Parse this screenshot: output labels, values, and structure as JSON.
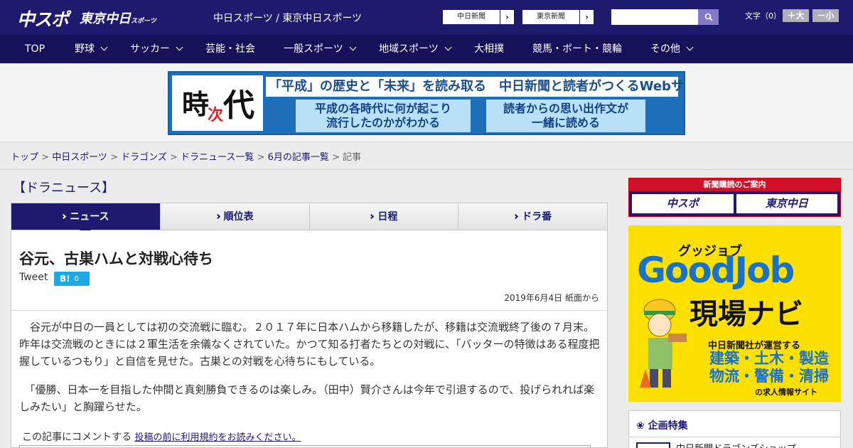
{
  "header": {
    "logo_main": "中スポ",
    "logo_sub": "東京中日",
    "logo_sub_small": "スポーツ",
    "title": "中日スポーツ / 東京中日スポーツ",
    "paper_links": [
      "中日新聞",
      "東京新聞"
    ],
    "fontsize_label": "文字（0）",
    "font_bigger": "＋大",
    "font_smaller": "－小"
  },
  "nav": {
    "items": [
      {
        "label": "TOP",
        "dropdown": false
      },
      {
        "label": "野球",
        "dropdown": true
      },
      {
        "label": "サッカー",
        "dropdown": true
      },
      {
        "label": "芸能・社会",
        "dropdown": false
      },
      {
        "label": "一般スポーツ",
        "dropdown": true
      },
      {
        "label": "地域スポーツ",
        "dropdown": true
      },
      {
        "label": "大相撲",
        "dropdown": false
      },
      {
        "label": "競馬・ボート・競輪",
        "dropdown": false
      },
      {
        "label": "その他",
        "dropdown": true
      }
    ]
  },
  "banner": {
    "kanji1": "時",
    "kanji2": "次",
    "kanji3": "代",
    "headline": "「平成」の歴史と「未来」を読み取る　中日新聞と読者がつくるWebサイト",
    "box1_line1": "平成の各時代に何が起こり",
    "box1_line2": "流行したのかがわかる",
    "box2_line1": "読者からの思い出作文が",
    "box2_line2": "一緒に読める"
  },
  "breadcrumb": {
    "items": [
      "トップ",
      "中日スポーツ",
      "ドラゴンズ",
      "ドラニュース一覧",
      "6月の記事一覧"
    ],
    "current": "記事",
    "sep": " > "
  },
  "section": {
    "title": "【ドラニュース】",
    "tabs": [
      "ニュース",
      "順位表",
      "日程",
      "ドラ番"
    ]
  },
  "article": {
    "title": "谷元、古巣ハムと対戦心待ち",
    "tweet": "Tweet",
    "hatena_b": "B!",
    "hatena_count": "0",
    "date": "2019年6月4日 紙面から",
    "para1": "　谷元が中日の一員としては初の交流戦に臨む。２０１７年に日本ハムから移籍したが、移籍は交流戦終了後の７月末。昨年は交流戦のときには２軍生活を余儀なくされていた。かつて知る打者たちとの対戦に、「バッターの特徴はある程度把握しているつもり」と自信を見せた。古巣との対戦を心待ちにもしている。",
    "para2": "　「優勝、日本一を目指した仲間と真剣勝負できるのは楽しみ。（田中）賢介さんは今年で引退するので、投げられれば楽しみたい」と胸躍らせた。",
    "comment_prompt": "この記事にコメントする",
    "comment_link": "投稿の前に利用規約をお読みください。"
  },
  "sidebar": {
    "sub_head": "新聞購読のご案内",
    "sub_logo1": "中スポ",
    "sub_logo2": "東京中日",
    "gj_kana": "グッジョブ",
    "gj_big": "GoodJob",
    "gj_navi": "現場ナビ",
    "gj_l1": "中日新聞社が運営する",
    "gj_l2a": "建築・土木・製造",
    "gj_l2b": "物流・警備・清掃",
    "gj_l3": "の求人情報サイト",
    "kikaku_head": "企画特集",
    "kikaku_item": "中日新聞ドラゴンズショップ"
  },
  "colors": {
    "brand_navy": "#1e1a6e",
    "nav_navy": "#15125a",
    "accent_red": "#d0102a",
    "goodjob_yellow": "#fce100"
  }
}
